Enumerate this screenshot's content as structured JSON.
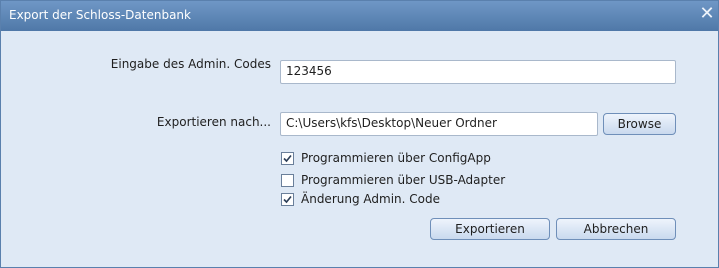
{
  "window": {
    "title": "Export der Schloss-Datenbank",
    "close_glyph": "✕"
  },
  "form": {
    "admin_code_label": "Eingabe des Admin. Codes",
    "admin_code_value": "123456",
    "export_path_label": "Exportieren nach...",
    "export_path_value": "C:\\Users\\kfs\\Desktop\\Neuer Ordner",
    "browse_label": "Browse"
  },
  "options": [
    {
      "label": "Programmieren über ConfigApp",
      "checked": true
    },
    {
      "label": "Programmieren über USB-Adapter",
      "checked": false
    },
    {
      "label": "Änderung Admin. Code",
      "checked": true
    }
  ],
  "actions": {
    "export_label": "Exportieren",
    "cancel_label": "Abbrechen"
  },
  "colors": {
    "titlebar": "#5b84b3",
    "client_background": "#dfe9f5",
    "button_border": "#6f8fb9"
  }
}
